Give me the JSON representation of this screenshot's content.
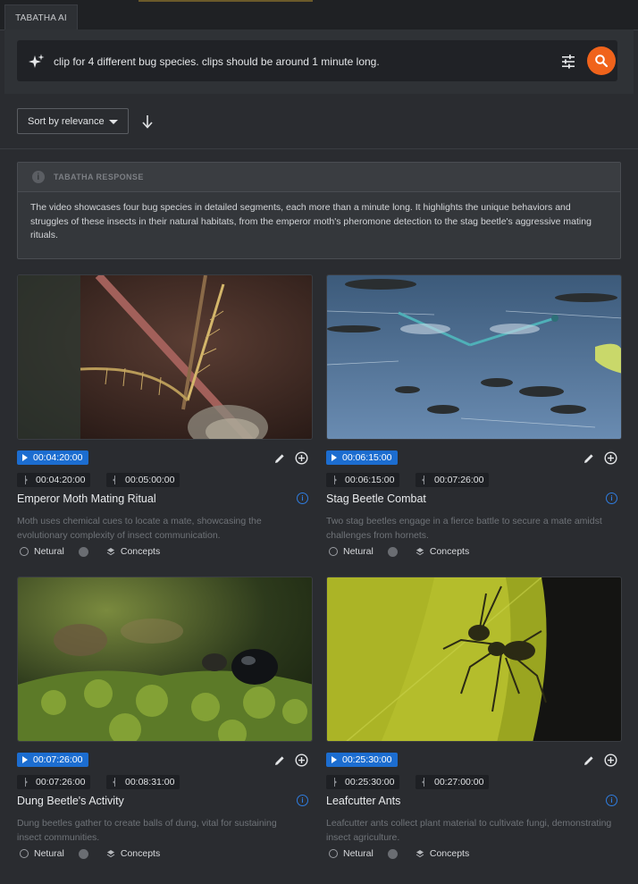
{
  "tab_label": "TABATHA AI",
  "search": {
    "query": "clip for 4 different bug species. clips should be around 1 minute long.",
    "sparkle_icon": "sparkle-icon",
    "filters_icon": "sliders-icon",
    "search_icon": "search-icon",
    "accent": "#f0631b"
  },
  "sort": {
    "label": "Sort by relevance",
    "direction_icon": "arrow-down-icon"
  },
  "response": {
    "heading": "TABATHA RESPONSE",
    "info_glyph": "i",
    "text": "The video showcases four bug species in detailed segments, each more than a minute long. It highlights the unique behaviors and struggles of these insects in their natural habitats, from the emperor moth's pheromone detection to the stag beetle's aggressive mating rituals."
  },
  "cards": [
    {
      "timecode": "00:04:20:00",
      "in": "00:04:20:00",
      "out": "00:05:00:00",
      "title": "Emperor Moth Mating Ritual",
      "description": "Moth uses chemical cues to locate a mate, showcasing the evolutionary complexity of insect communication.",
      "tag1": "Netural",
      "tag2": "Concepts",
      "info_glyph": "i"
    },
    {
      "timecode": "00:06:15:00",
      "in": "00:06:15:00",
      "out": "00:07:26:00",
      "title": "Stag Beetle Combat",
      "description": "Two stag beetles engage in a fierce battle to secure a mate amidst challenges from hornets.",
      "tag1": "Netural",
      "tag2": "Concepts",
      "info_glyph": "i"
    },
    {
      "timecode": "00:07:26:00",
      "in": "00:07:26:00",
      "out": "00:08:31:00",
      "title": "Dung Beetle's Activity",
      "description": "Dung beetles gather to create balls of dung, vital for sustaining insect communities.",
      "tag1": "Netural",
      "tag2": "Concepts",
      "info_glyph": "i"
    },
    {
      "timecode": "00:25:30:00",
      "in": "00:25:30:00",
      "out": "00:27:00:00",
      "title": "Leafcutter Ants",
      "description": "Leafcutter ants collect plant material to cultivate fungi, demonstrating insect agriculture.",
      "tag1": "Netural",
      "tag2": "Concepts",
      "info_glyph": "i"
    }
  ],
  "colors": {
    "timecode_blue": "#1c6dd0",
    "info_blue": "#2f7de0",
    "background": "#2a2c30"
  }
}
